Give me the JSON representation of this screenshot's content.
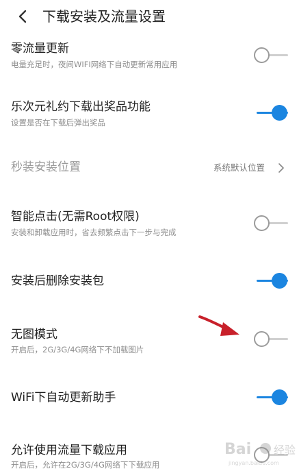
{
  "header": {
    "title": "下载安装及流量设置",
    "back_icon": "back-chevron-icon"
  },
  "settings": [
    {
      "label": "零流量更新",
      "sub": "电量充足时，夜间WIFI网络下自动更新常用应用",
      "control": "toggle",
      "on": false
    },
    {
      "label": "乐次元礼约下载出奖品功能",
      "sub": "设置是否在下载后弹出奖品",
      "control": "toggle",
      "on": true
    },
    {
      "label": "秒装安装位置",
      "value": "系统默认位置",
      "control": "link"
    },
    {
      "label": "智能点击(无需Root权限)",
      "sub": "安装和卸载应用时，省去频繁点击下一步与完成",
      "control": "toggle",
      "on": false
    },
    {
      "label": "安装后删除安装包",
      "control": "toggle",
      "on": true
    },
    {
      "label": "无图模式",
      "sub": "开启后，2G/3G/4G网络下不加载图片",
      "control": "toggle",
      "on": false
    },
    {
      "label": "WiFi下自动更新助手",
      "control": "toggle",
      "on": true
    },
    {
      "label": "允许使用流量下载应用",
      "sub": "开启后，允许在2G/3G/4G网络下下载应用",
      "control": "toggle",
      "on": false
    }
  ],
  "watermark": {
    "text": "Bai",
    "sub": "jingyan.baidu.com"
  },
  "colors": {
    "accent": "#1b85e0",
    "annotation_arrow": "#c8202a",
    "toggle_off": "#9b9b9b"
  }
}
